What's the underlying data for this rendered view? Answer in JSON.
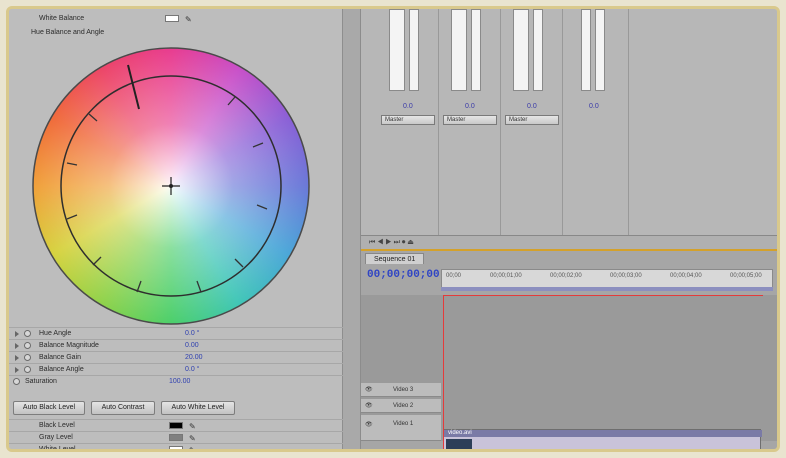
{
  "effect_controls": {
    "white_balance_label": "White Balance",
    "hue_balance_label": "Hue Balance and Angle",
    "params": [
      {
        "label": "Hue Angle",
        "value": "0.0 °"
      },
      {
        "label": "Balance Magnitude",
        "value": "0.00"
      },
      {
        "label": "Balance Gain",
        "value": "20.00"
      },
      {
        "label": "Balance Angle",
        "value": "0.0 °"
      },
      {
        "label": "Saturation",
        "value": "100.00"
      }
    ],
    "buttons": [
      "Auto Black Level",
      "Auto Contrast",
      "Auto White Level"
    ],
    "levels": [
      {
        "label": "Black Level",
        "swatch": "#000000"
      },
      {
        "label": "Gray Level",
        "swatch": "#808080"
      },
      {
        "label": "White Level",
        "swatch": "#ffffff"
      }
    ],
    "white_balance_swatch": "#ffffff"
  },
  "mixer": {
    "tracks": [
      {
        "value": "0.0",
        "output": "Master"
      },
      {
        "value": "0.0",
        "output": "Master"
      },
      {
        "value": "0.0",
        "output": "Master"
      },
      {
        "value": "0.0",
        "output": ""
      }
    ]
  },
  "timeline": {
    "tab_label": "Sequence 01",
    "timecode": "00;00;00;00",
    "ruler_ticks": [
      "00;00",
      "00;00;01;00",
      "00;00;02;00",
      "00;00;03;00",
      "00;00;04;00",
      "00;00;05;00"
    ],
    "video_tracks": [
      "Video 3",
      "Video 2",
      "Video 1"
    ],
    "clip_label": "video.avi"
  },
  "colors": {
    "accent": "#d4a12a",
    "value_blue": "#2f40b0",
    "playhead": "#e43b3b"
  }
}
